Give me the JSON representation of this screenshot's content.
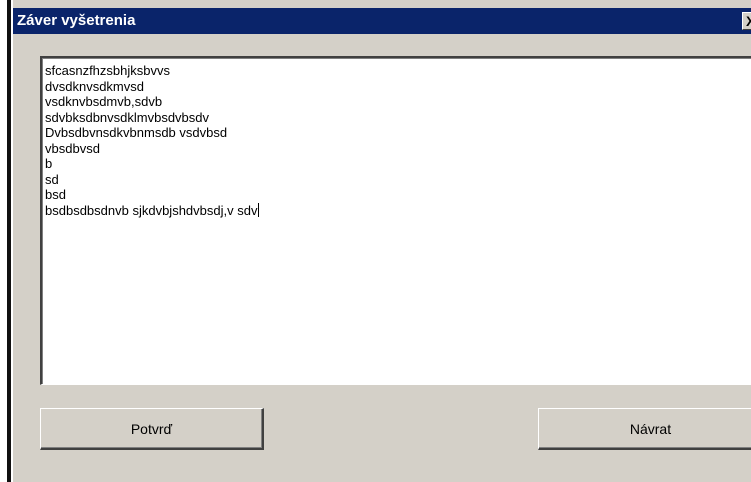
{
  "window": {
    "title": "Záver vyšetrenia",
    "close_glyph": "X"
  },
  "text_area": {
    "lines": [
      "sfcasnzfhzsbhjksbvvs",
      "dvsdknvsdkmvsd",
      "vsdknvbsdmvb,sdvb",
      "sdvbksdbnvsdklmvbsdvbsdv",
      "Dvbsdbvnsdkvbnmsdb vsdvbsd",
      "vbsdbvsd",
      "b",
      "sd",
      "bsd",
      "bsdbsdbsdnvb sjkdvbjshdvbsdj,v sdv"
    ]
  },
  "buttons": {
    "confirm_label": "Potvrď",
    "back_label": "Návrat"
  }
}
